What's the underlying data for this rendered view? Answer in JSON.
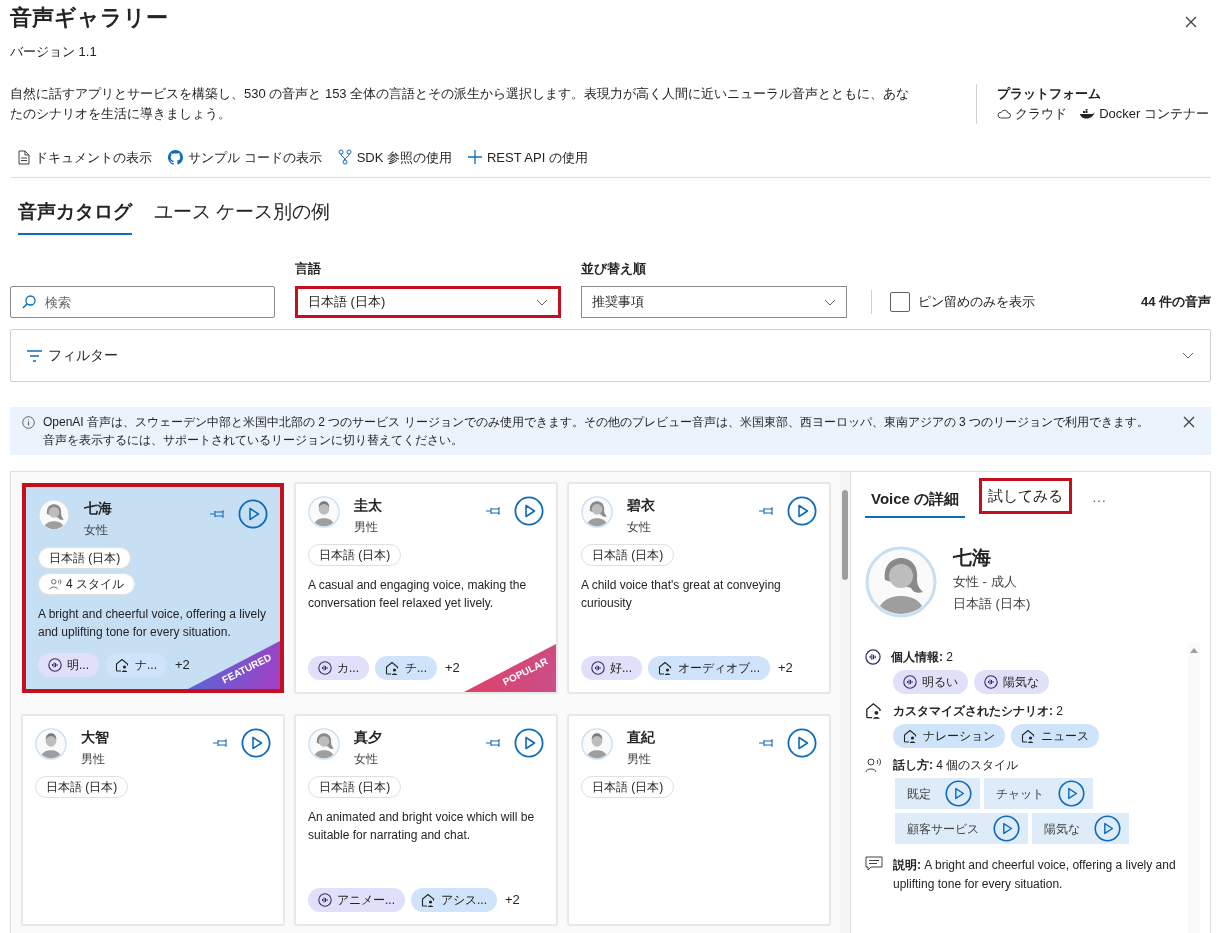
{
  "header": {
    "title": "音声ギャラリー",
    "version": "バージョン 1.1"
  },
  "description": "自然に話すアプリとサービスを構築し、530 の音声と 153 全体の言語とその派生から選択します。表現力が高く人間に近いニューラル音声とともに、あなたのシナリオを生活に導きましょう。",
  "platform": {
    "label": "プラットフォーム",
    "items": [
      {
        "kind": "cloud",
        "label": "クラウド"
      },
      {
        "kind": "docker",
        "label": "Docker コンテナー"
      }
    ]
  },
  "links": [
    {
      "kind": "document",
      "label": "ドキュメントの表示"
    },
    {
      "kind": "github",
      "label": "サンプル コードの表示"
    },
    {
      "kind": "branch",
      "label": "SDK 参照の使用"
    },
    {
      "kind": "plus",
      "label": "REST API の使用"
    }
  ],
  "tabs": [
    {
      "label": "音声カタログ",
      "selected": true
    },
    {
      "label": "ユース ケース別の例",
      "selected": false
    }
  ],
  "search": {
    "placeholder": "検索"
  },
  "language": {
    "label": "言語",
    "value": "日本語 (日本)",
    "highlighted": true
  },
  "sort": {
    "label": "並び替え順",
    "value": "推奨事項",
    "highlighted": false
  },
  "pinned_only": {
    "label": "ピン留めのみを表示",
    "checked": false
  },
  "count": "44 件の音声",
  "filter": {
    "label": "フィルター",
    "expanded": false
  },
  "notice": "OpenAI 音声は、スウェーデン中部と米国中北部の 2 つのサービス リージョンでのみ使用できます。その他のプレビュー音声は、米国東部、西ヨーロッパ、東南アジアの 3 つのリージョンで利用できます。音声を表示するには、サポートされているリージョンに切り替えてください。",
  "voices": [
    {
      "name": "七海",
      "gender": "女性",
      "kind": "female",
      "language": "日本語 (日本)",
      "styles": "4 スタイル",
      "description": "A bright and cheerful voice, offering a lively and uplifting tone for every situation.",
      "tags": [
        {
          "kind": "personality",
          "label": "明..."
        },
        {
          "kind": "scenario",
          "label": "ナ..."
        }
      ],
      "more": "+2",
      "badge": {
        "kind": "featured",
        "text": "FEATURED"
      },
      "selected": true,
      "highlighted": true
    },
    {
      "name": "圭太",
      "gender": "男性",
      "kind": "male",
      "language": "日本語 (日本)",
      "description": "A casual and engaging voice, making the conversation feel relaxed yet lively.",
      "tags": [
        {
          "kind": "personality",
          "label": "カ..."
        },
        {
          "kind": "scenario",
          "label": "チ..."
        }
      ],
      "more": "+2",
      "badge": {
        "kind": "popular",
        "text": "POPULAR"
      },
      "selected": false,
      "highlighted": false
    },
    {
      "name": "碧衣",
      "gender": "女性",
      "kind": "female",
      "language": "日本語 (日本)",
      "description": "A child voice that's great at conveying curiousity",
      "tags": [
        {
          "kind": "personality",
          "label": "好..."
        },
        {
          "kind": "scenario",
          "label": "オーディオブ..."
        }
      ],
      "more": "+2",
      "selected": false,
      "highlighted": false
    },
    {
      "name": "大智",
      "gender": "男性",
      "kind": "male",
      "language": "日本語 (日本)",
      "selected": false,
      "highlighted": false
    },
    {
      "name": "真夕",
      "gender": "女性",
      "kind": "female",
      "language": "日本語 (日本)",
      "description": "An animated and bright voice which will be suitable for narrating and chat.",
      "tags": [
        {
          "kind": "personality",
          "label": "アニメー..."
        },
        {
          "kind": "scenario",
          "label": "アシス..."
        }
      ],
      "more": "+2",
      "selected": false,
      "highlighted": false
    },
    {
      "name": "直紀",
      "gender": "男性",
      "kind": "male",
      "language": "日本語 (日本)",
      "selected": false,
      "highlighted": false
    }
  ],
  "details": {
    "tabs": [
      {
        "label": "Voice の詳細",
        "selected": true,
        "highlighted": false
      },
      {
        "label": "試してみる",
        "selected": false,
        "highlighted": true
      }
    ],
    "more": "···",
    "name": "七海",
    "subtitle": "女性 - 成人",
    "language": "日本語 (日本)",
    "kind": "female",
    "personality": {
      "heading": "**個人情報:** 2",
      "tags": [
        {
          "kind": "personality",
          "label": "明るい"
        },
        {
          "kind": "personality",
          "label": "陽気な"
        }
      ]
    },
    "scenarios": {
      "heading": "**カスタマイズされたシナリオ:** 2",
      "tags": [
        {
          "kind": "scenario",
          "label": "ナレーション"
        },
        {
          "kind": "scenario",
          "label": "ニュース"
        }
      ]
    },
    "speaking": {
      "heading": "**話し方:** 4 個のスタイル",
      "styles": [
        "既定",
        "チャット",
        "顧客サービス",
        "陽気な"
      ]
    },
    "description": "**説明:** A bright and cheerful voice, offering a lively and uplifting tone for every situation."
  }
}
